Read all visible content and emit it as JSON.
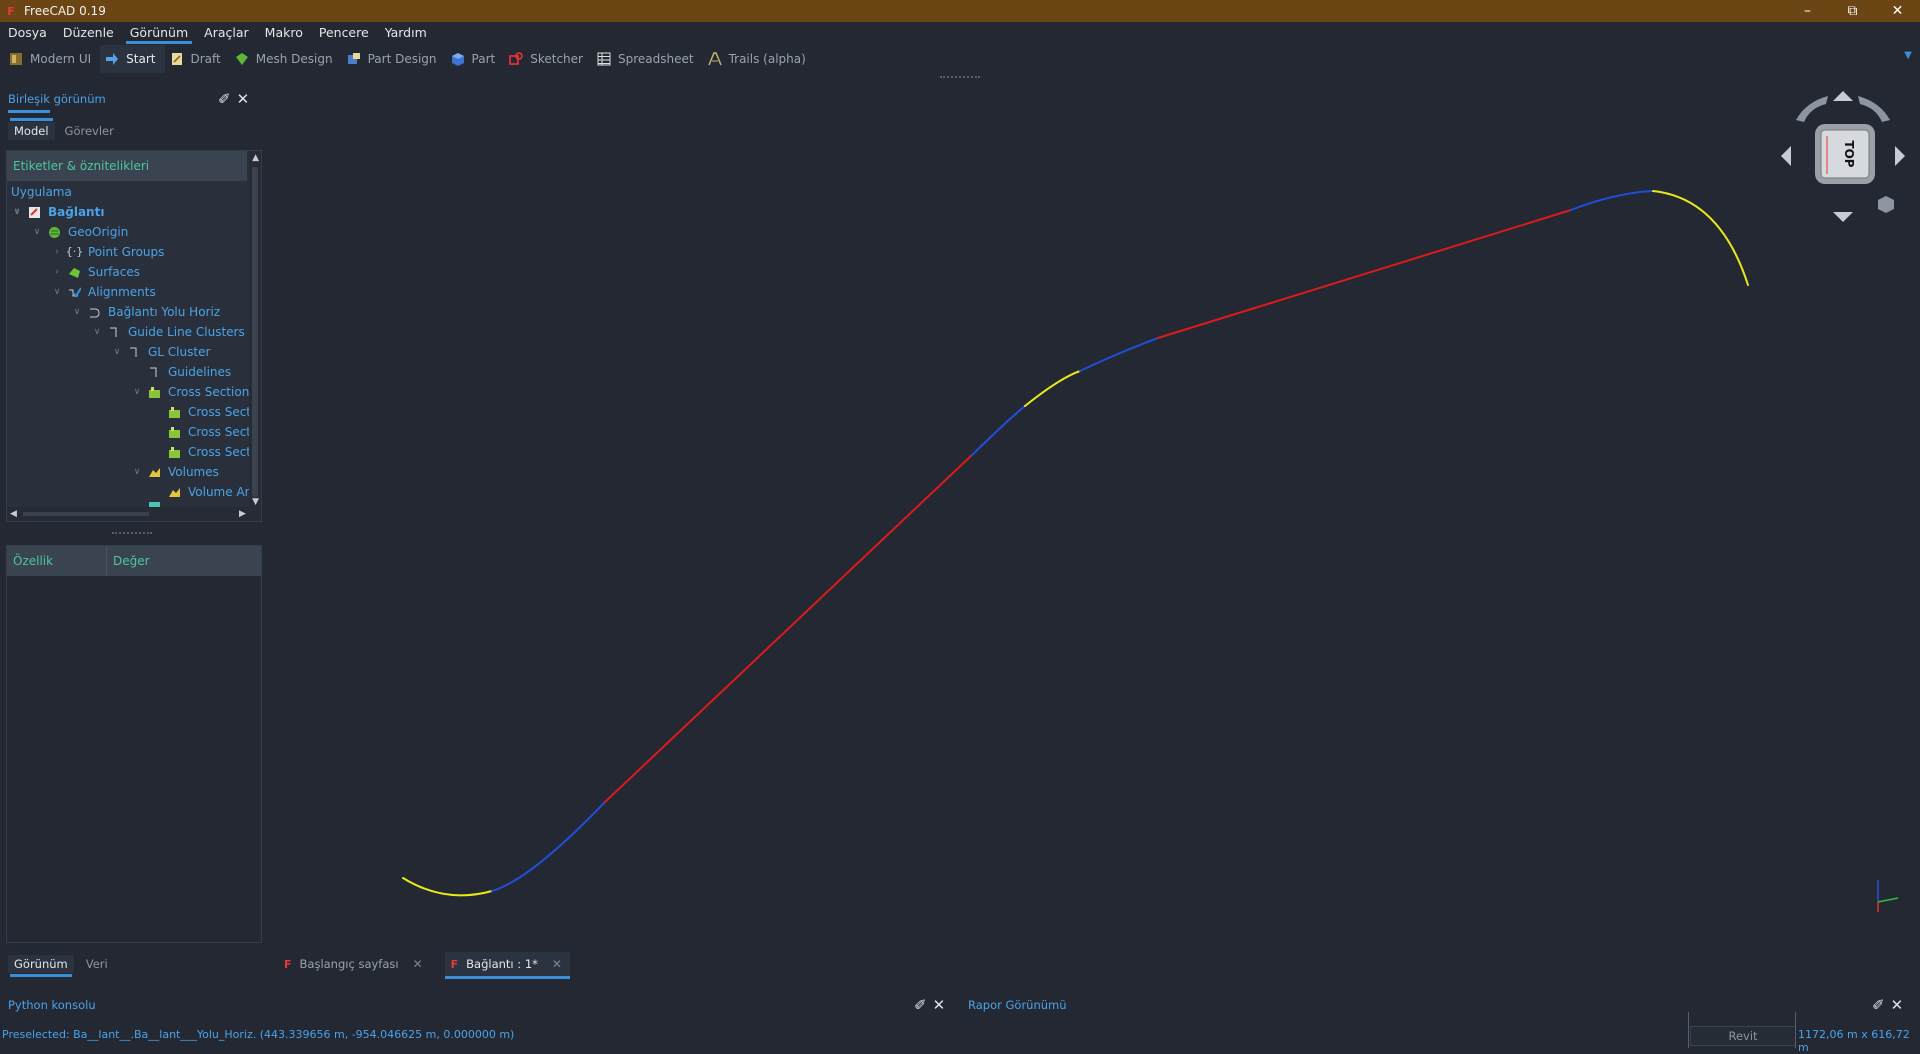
{
  "window": {
    "title": "FreeCAD 0.19"
  },
  "menu": [
    "Dosya",
    "Düzenle",
    "Görünüm",
    "Araçlar",
    "Makro",
    "Pencere",
    "Yardım"
  ],
  "workbenches": [
    {
      "label": "Modern UI",
      "icon": "modern-ui-icon"
    },
    {
      "label": "Start",
      "icon": "start-arrow-icon"
    },
    {
      "label": "Draft",
      "icon": "draft-icon"
    },
    {
      "label": "Mesh Design",
      "icon": "mesh-icon"
    },
    {
      "label": "Part Design",
      "icon": "part-design-icon"
    },
    {
      "label": "Part",
      "icon": "part-cube-icon"
    },
    {
      "label": "Sketcher",
      "icon": "sketcher-icon"
    },
    {
      "label": "Spreadsheet",
      "icon": "spreadsheet-icon"
    },
    {
      "label": "Trails (alpha)",
      "icon": "trails-icon"
    }
  ],
  "combo": {
    "title": "Birleşik görünüm",
    "tabs": [
      "Model",
      "Görevler"
    ],
    "tree_header": "Etiketler & öznitelikleri",
    "tree": [
      {
        "label": "Uygulama"
      },
      {
        "label": "Bağlantı"
      },
      {
        "label": "GeoOrigin"
      },
      {
        "label": "Point Groups"
      },
      {
        "label": "Surfaces"
      },
      {
        "label": "Alignments"
      },
      {
        "label": "Bağlantı Yolu Horiz"
      },
      {
        "label": "Guide Line Clusters"
      },
      {
        "label": "GL Cluster"
      },
      {
        "label": "Guidelines"
      },
      {
        "label": "Cross Sections"
      },
      {
        "label": "Cross Sect"
      },
      {
        "label": "Cross Sect"
      },
      {
        "label": "Cross Sect"
      },
      {
        "label": "Volumes"
      },
      {
        "label": "Volume Ar"
      }
    ],
    "props_header": {
      "property": "Özellik",
      "value": "Değer"
    },
    "bottom_tabs": [
      "Görünüm",
      "Veri"
    ]
  },
  "nav_cube": {
    "face_label": "TOP"
  },
  "doc_tabs": [
    {
      "label": "Başlangıç sayfası"
    },
    {
      "label": "Bağlantı : 1*"
    }
  ],
  "panels": {
    "python": "Python konsolu",
    "report": "Rapor Görünümü"
  },
  "status": {
    "preselected": "Preselected: Ba__lant__.Ba__lant___Yolu_Horiz. (443.339656 m, -954.046625 m, 0.000000 m)",
    "nav_style": "Revit",
    "dimensions": "1172,06 m x 616,72 m"
  },
  "colors": {
    "tangent": "#dd1a1a",
    "spiral": "#1f4fd6",
    "curve": "#e8e81a",
    "accent": "#3a8fd8"
  }
}
